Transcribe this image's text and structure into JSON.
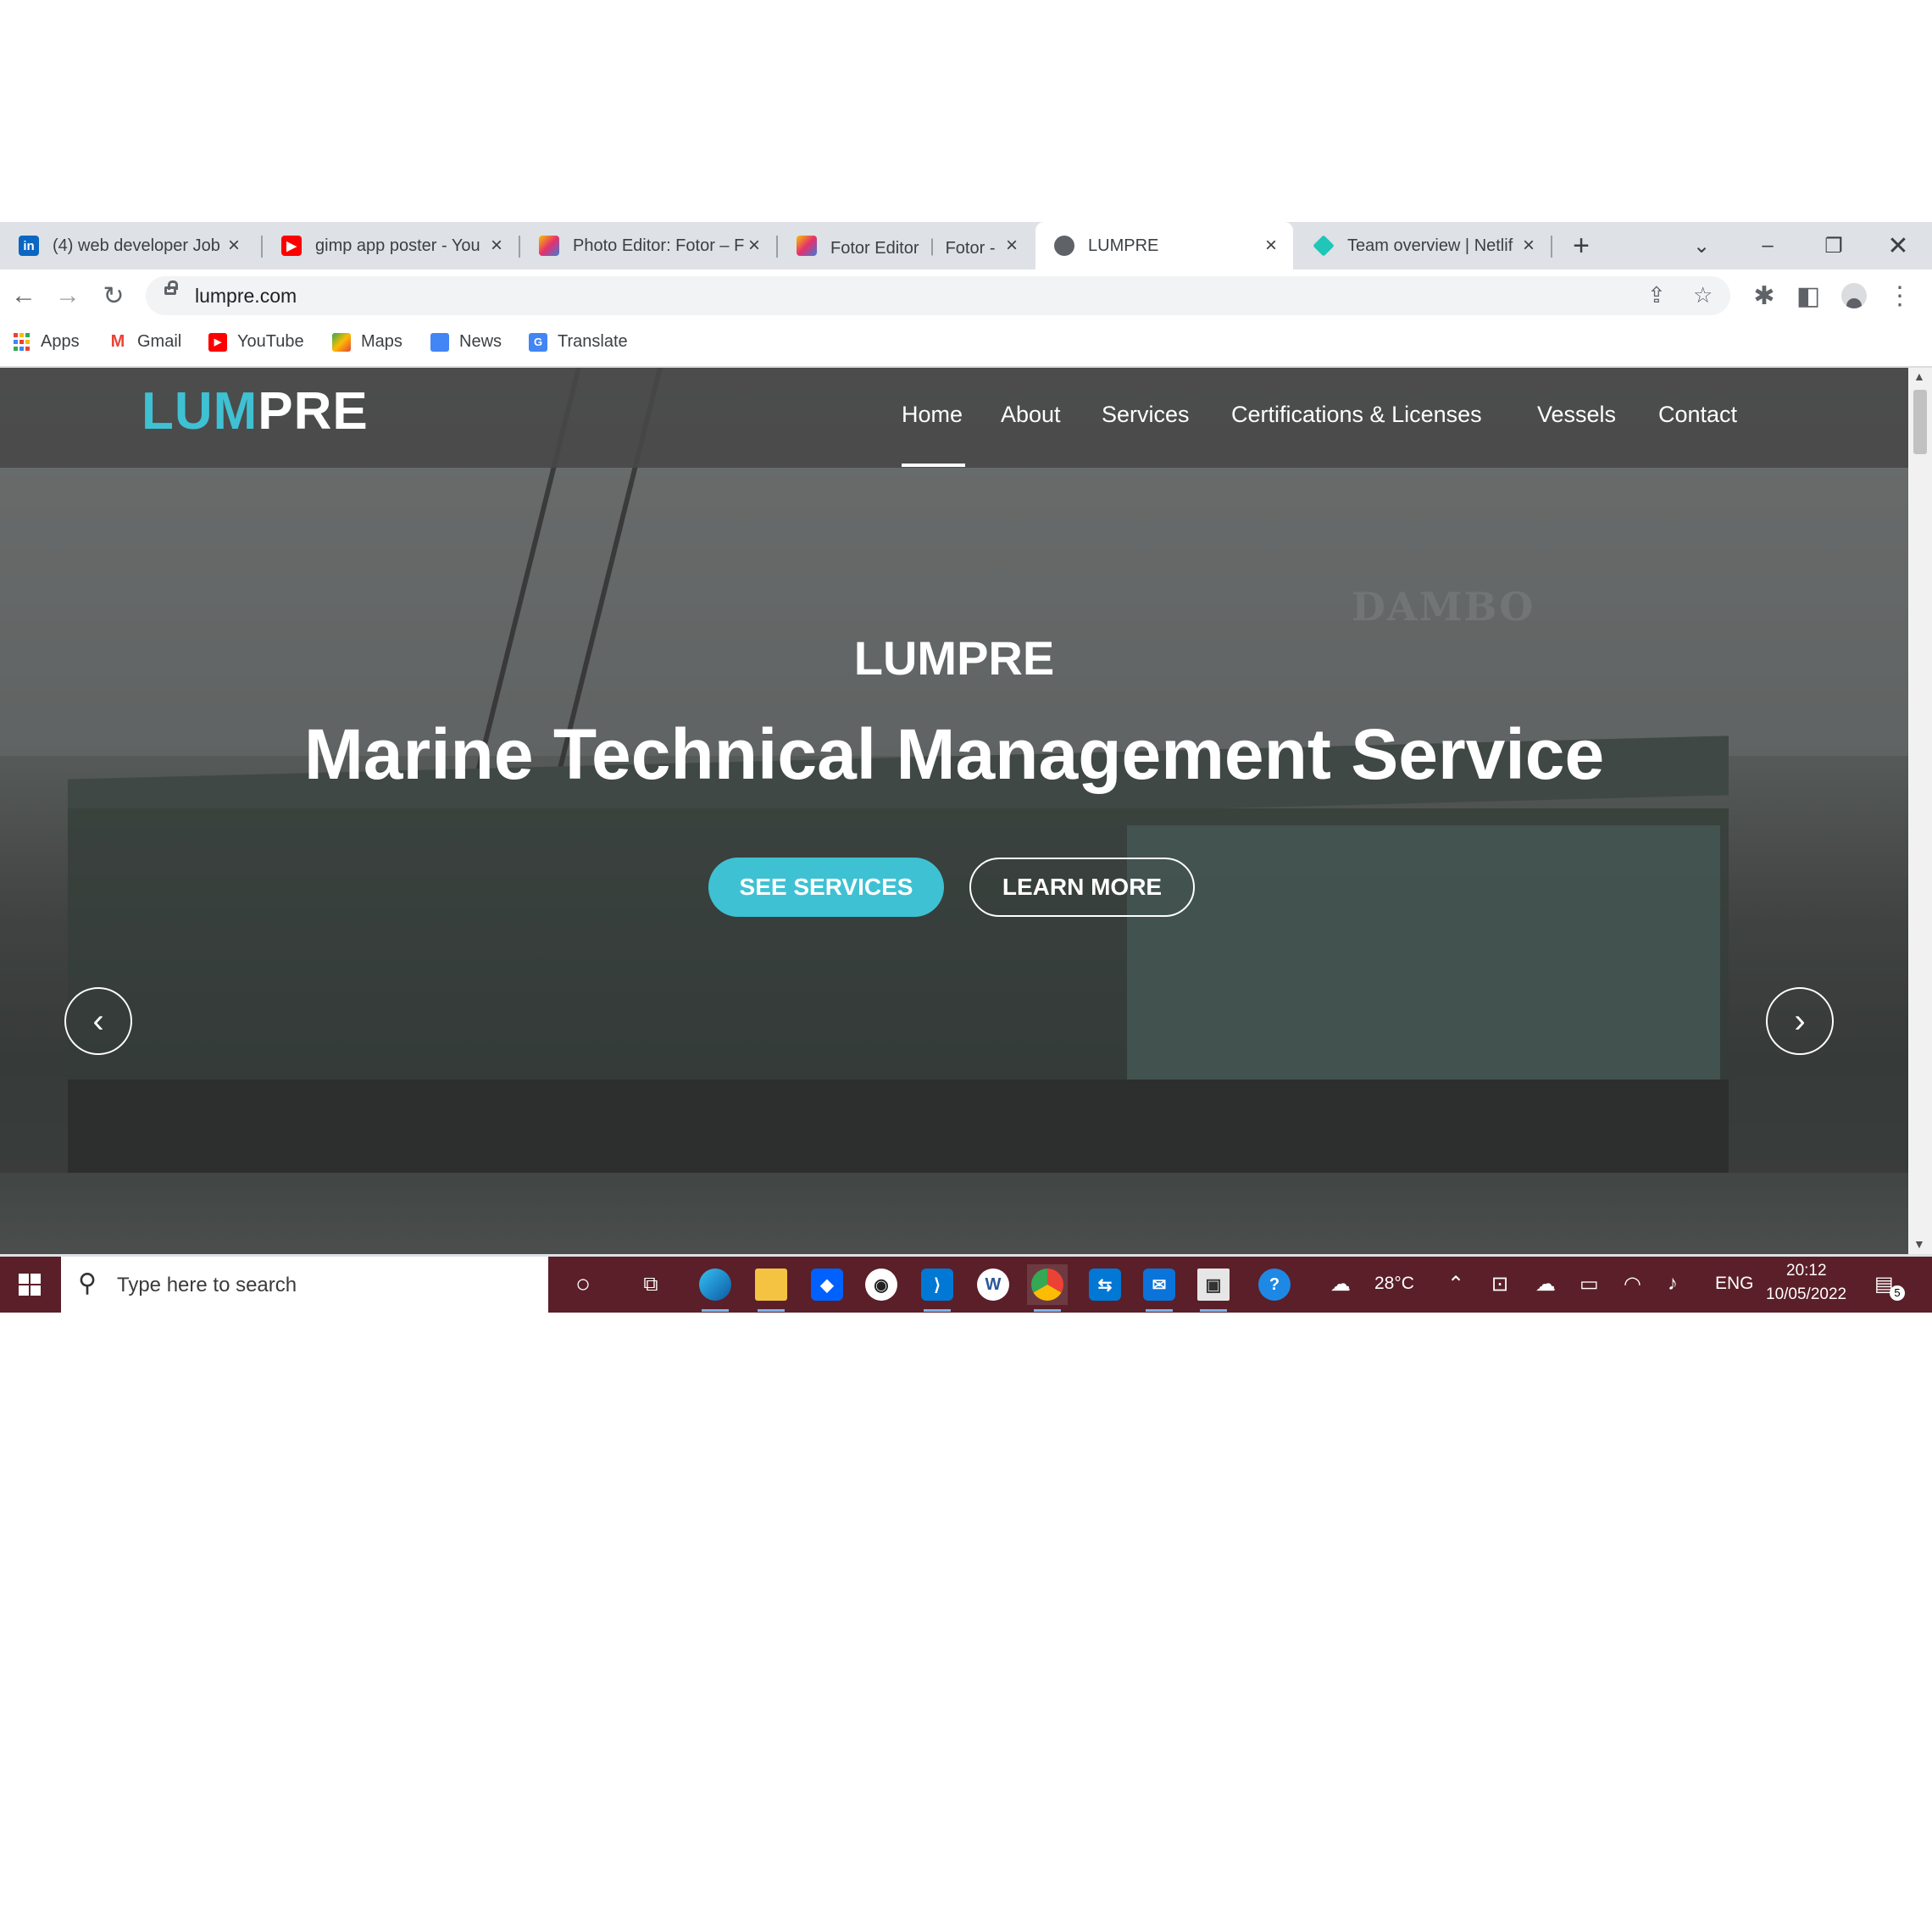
{
  "browser": {
    "tabs": [
      {
        "title": "(4) web developer Job",
        "favicon": "linkedin-icon",
        "color": "#0a66c2",
        "glyph": "in"
      },
      {
        "title": "gimp app poster - You",
        "favicon": "youtube-icon",
        "color": "#ff0000",
        "glyph": "▶"
      },
      {
        "title": "Photo Editor: Fotor – F",
        "favicon": "fotor-icon",
        "color": "#e8a21b",
        "glyph": "▦"
      },
      {
        "title": "Fotor Editor ｜ Fotor -",
        "favicon": "fotor-icon",
        "color": "#e8a21b",
        "glyph": "▦"
      },
      {
        "title": "LUMPRE",
        "favicon": "globe-icon",
        "color": "#5f6368",
        "glyph": "◍"
      },
      {
        "title": "Team overview | Netlif",
        "favicon": "netlify-icon",
        "color": "#20c6b7",
        "glyph": "◆"
      }
    ],
    "active_tab_index": 4,
    "new_tab_label": "+",
    "url": "lumpre.com",
    "bookmarks": [
      {
        "label": "Apps",
        "icon": "apps-grid-icon",
        "color": "#ea4335",
        "glyph": "⋮⋮"
      },
      {
        "label": "Gmail",
        "icon": "gmail-icon",
        "color": "#ea4335",
        "glyph": "M"
      },
      {
        "label": "YouTube",
        "icon": "youtube-icon",
        "color": "#ff0000",
        "glyph": "▶"
      },
      {
        "label": "Maps",
        "icon": "maps-icon",
        "color": "#34a853",
        "glyph": "⌖"
      },
      {
        "label": "News",
        "icon": "news-icon",
        "color": "#4285f4",
        "glyph": "N"
      },
      {
        "label": "Translate",
        "icon": "translate-icon",
        "color": "#4285f4",
        "glyph": "G"
      }
    ]
  },
  "site": {
    "logo_part1": "LUM",
    "logo_part2": "PRE",
    "nav": [
      "Home",
      "About",
      "Services",
      "Certifications & Licenses",
      "Vessels",
      "Contact"
    ],
    "active_nav": "Home",
    "hero_subtitle": "LUMPRE",
    "hero_title": "Marine Technical Management Service",
    "primary_button": "SEE SERVICES",
    "secondary_button": "LEARN MORE",
    "accent_color": "#3ec1d3",
    "barge_sign": "DAMBO"
  },
  "taskbar": {
    "search_placeholder": "Type here to search",
    "weather": "28°C",
    "language": "ENG",
    "time": "20:12",
    "date": "10/05/2022",
    "notification_count": "5"
  }
}
